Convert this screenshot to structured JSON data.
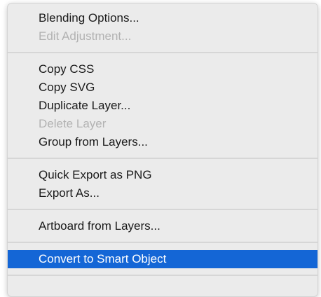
{
  "menu": {
    "groups": [
      [
        {
          "label": "Blending Options...",
          "enabled": true
        },
        {
          "label": "Edit Adjustment...",
          "enabled": false
        }
      ],
      [
        {
          "label": "Copy CSS",
          "enabled": true
        },
        {
          "label": "Copy SVG",
          "enabled": true
        },
        {
          "label": "Duplicate Layer...",
          "enabled": true
        },
        {
          "label": "Delete Layer",
          "enabled": false
        },
        {
          "label": "Group from Layers...",
          "enabled": true
        }
      ],
      [
        {
          "label": "Quick Export as PNG",
          "enabled": true
        },
        {
          "label": "Export As...",
          "enabled": true
        }
      ],
      [
        {
          "label": "Artboard from Layers...",
          "enabled": true
        }
      ],
      [
        {
          "label": "Convert to Smart Object",
          "enabled": true,
          "highlighted": true
        }
      ]
    ]
  },
  "colors": {
    "menu_background": "#ebebeb",
    "text": "#1a1a1a",
    "disabled_text": "#b2b2b2",
    "highlight": "#1466d6",
    "highlight_text": "#ffffff",
    "separator": "#d6d6d6"
  }
}
